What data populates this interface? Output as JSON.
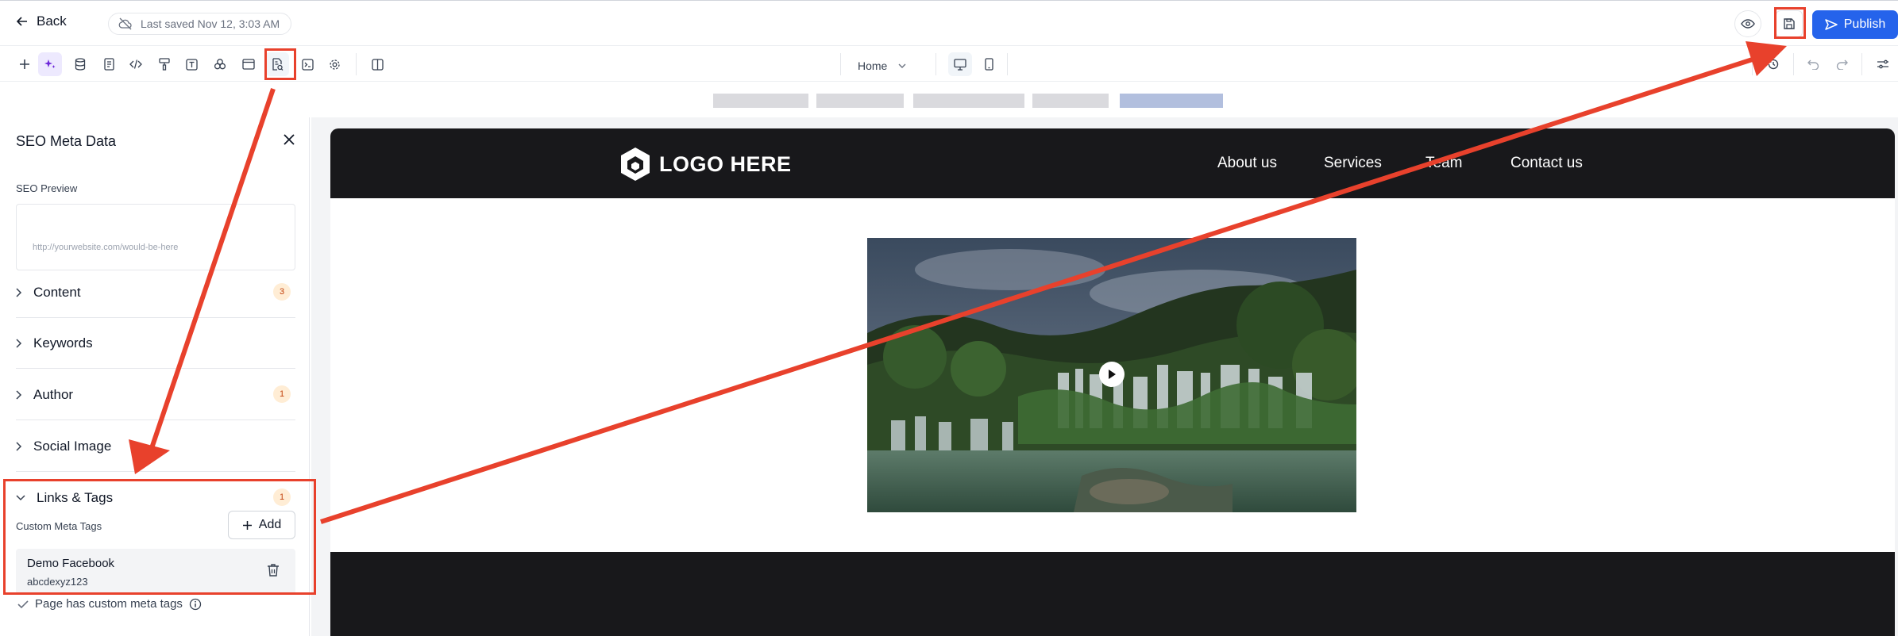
{
  "topbar": {
    "back_label": "Back",
    "last_saved": "Last saved Nov 12, 3:03 AM",
    "publish_label": "Publish"
  },
  "toolbar": {
    "page_selector": "Home"
  },
  "seo_panel": {
    "title": "SEO Meta Data",
    "preview_label": "SEO Preview",
    "preview_url": "http://yourwebsite.com/would-be-here",
    "sections": [
      {
        "label": "Content",
        "badge": "3"
      },
      {
        "label": "Keywords",
        "badge": ""
      },
      {
        "label": "Author",
        "badge": "1"
      },
      {
        "label": "Social Image",
        "badge": ""
      },
      {
        "label": "Links & Tags",
        "badge": "1"
      }
    ],
    "custom_meta_tags_label": "Custom Meta Tags",
    "add_label": "Add",
    "meta_tag": {
      "name": "Demo Facebook",
      "value": "abcdexyz123"
    },
    "custom_note": "Page has custom meta tags"
  },
  "site": {
    "logo_text": "LOGO HERE",
    "nav_links": [
      "About us",
      "Services",
      "Team",
      "Contact us"
    ]
  },
  "colors": {
    "accent": "#2563eb",
    "annotation": "#e8412c",
    "nav_bg": "#18181b",
    "badge_bg": "#ffedd5"
  }
}
